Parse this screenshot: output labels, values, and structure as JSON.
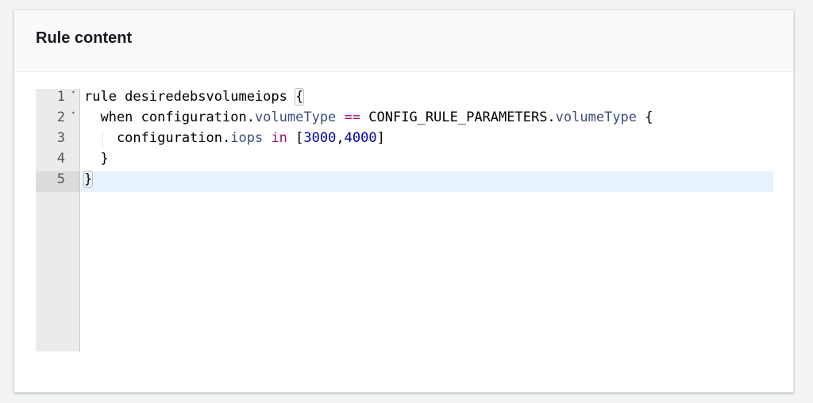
{
  "panel": {
    "title": "Rule content"
  },
  "editor": {
    "active_line": 5,
    "lines": [
      {
        "number": "1",
        "foldable": true,
        "tokens": [
          {
            "t": "rule desiredebsvolumeiops ",
            "c": ""
          },
          {
            "t": "{",
            "c": "t-brace-hl"
          }
        ]
      },
      {
        "number": "2",
        "foldable": true,
        "tokens": [
          {
            "t": "  when configuration.",
            "c": ""
          },
          {
            "t": "volumeType",
            "c": "t-prop"
          },
          {
            "t": " ",
            "c": ""
          },
          {
            "t": "==",
            "c": "t-op"
          },
          {
            "t": " CONFIG_RULE_PARAMETERS.",
            "c": ""
          },
          {
            "t": "volumeType",
            "c": "t-prop"
          },
          {
            "t": " {",
            "c": ""
          }
        ]
      },
      {
        "number": "3",
        "foldable": false,
        "tokens": [
          {
            "t": "    configuration.",
            "c": ""
          },
          {
            "t": "iops",
            "c": "t-prop"
          },
          {
            "t": " ",
            "c": ""
          },
          {
            "t": "in",
            "c": "t-kw"
          },
          {
            "t": " [",
            "c": ""
          },
          {
            "t": "3000",
            "c": "t-num"
          },
          {
            "t": ",",
            "c": ""
          },
          {
            "t": "4000",
            "c": "t-num"
          },
          {
            "t": "]",
            "c": ""
          }
        ]
      },
      {
        "number": "4",
        "foldable": false,
        "tokens": [
          {
            "t": "  }",
            "c": ""
          }
        ]
      },
      {
        "number": "5",
        "foldable": false,
        "tokens": [
          {
            "t": "}",
            "c": "t-brace-hl"
          }
        ]
      }
    ]
  }
}
